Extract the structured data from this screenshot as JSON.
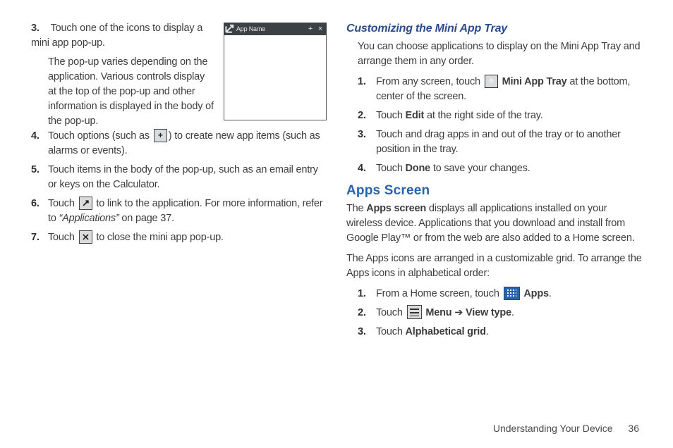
{
  "left": {
    "steps": [
      {
        "num": "3.",
        "text": "Touch one of the icons to display a mini app pop-up.",
        "sub": "The pop-up varies depending on the application. Various controls display at the top of the pop-up and other information is displayed in the body of the pop-up."
      },
      {
        "num": "4.",
        "pre": "Touch options (such as ",
        "post": ") to create new app items (such as alarms or events)."
      },
      {
        "num": "5.",
        "text": "Touch items in the body of the pop-up, such as an email entry or keys on the Calculator."
      },
      {
        "num": "6.",
        "pre": "Touch ",
        "mid": " to link to the application. For more information, refer to ",
        "ref": "“Applications”",
        "post": "  on page 37."
      },
      {
        "num": "7.",
        "pre": "Touch ",
        "post": " to close the mini app pop-up."
      }
    ],
    "miniwin": {
      "title": "App Name"
    }
  },
  "right": {
    "customizing": {
      "heading": "Customizing the Mini App Tray",
      "intro": "You can choose applications to display on the Mini App Tray and arrange them in any order.",
      "steps": [
        {
          "num": "1.",
          "pre": "From any screen, touch ",
          "bold": "Mini App Tray",
          "post": " at the bottom, center of the screen."
        },
        {
          "num": "2.",
          "pre": "Touch ",
          "bold": "Edit",
          "post": " at the right side of the tray."
        },
        {
          "num": "3.",
          "text": "Touch and drag apps in and out of the tray or to another position in the tray."
        },
        {
          "num": "4.",
          "pre": "Touch ",
          "bold": "Done",
          "post": " to save your changes."
        }
      ]
    },
    "apps": {
      "heading": "Apps Screen",
      "p1_pre": "The ",
      "p1_bold": "Apps screen",
      "p1_post": " displays all applications installed on your wireless device. Applications that you download and install from Google Play™ or from the web are also added to a Home screen.",
      "p2": "The Apps icons are arranged in a customizable grid. To arrange the Apps icons in alphabetical order:",
      "steps": [
        {
          "num": "1.",
          "pre": "From a Home screen, touch ",
          "bold": "Apps",
          "post": "."
        },
        {
          "num": "2.",
          "pre": "Touch ",
          "bold1": "Menu",
          "arrow": " ➔ ",
          "bold2": "View type",
          "post": "."
        },
        {
          "num": "3.",
          "pre": "Touch ",
          "bold": "Alphabetical grid",
          "post": "."
        }
      ]
    }
  },
  "footer": {
    "chapter": "Understanding Your Device",
    "page": "36"
  }
}
